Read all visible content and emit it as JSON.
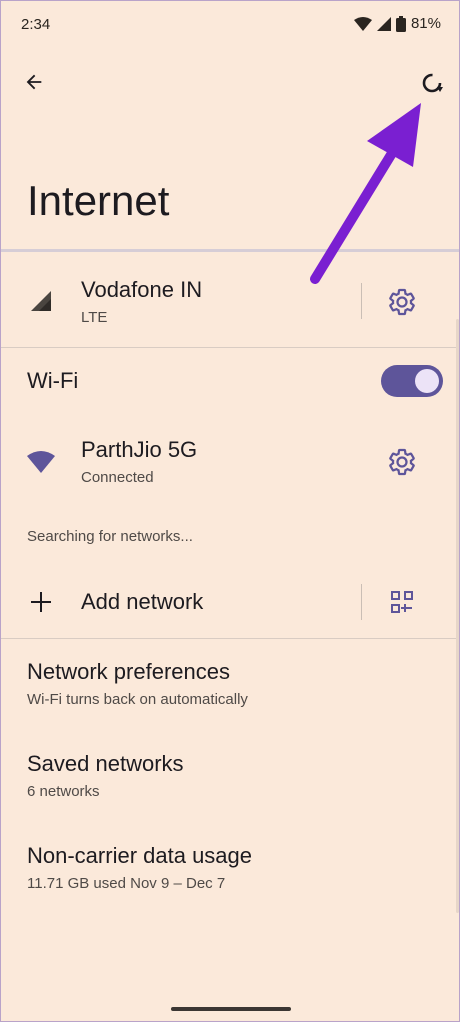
{
  "status_bar": {
    "time": "2:34",
    "battery": "81%"
  },
  "header": {
    "title": "Internet"
  },
  "mobile": {
    "carrier": "Vodafone IN",
    "network_type": "LTE"
  },
  "wifi": {
    "label": "Wi-Fi",
    "enabled": true
  },
  "connected_network": {
    "name": "ParthJio 5G",
    "status": "Connected"
  },
  "searching_text": "Searching for networks...",
  "add_network": {
    "label": "Add network"
  },
  "network_preferences": {
    "title": "Network preferences",
    "subtitle": "Wi-Fi turns back on automatically"
  },
  "saved_networks": {
    "title": "Saved networks",
    "subtitle": "6 networks"
  },
  "non_carrier_usage": {
    "title": "Non-carrier data usage",
    "subtitle": "11.71 GB used Nov 9 – Dec 7"
  },
  "colors": {
    "background": "#fbe9da",
    "accent": "#5e559a",
    "annotation_arrow": "#7a1fd1"
  },
  "icons": {
    "back": "arrow-left-icon",
    "refresh": "refresh-icon",
    "signal": "signal-icon",
    "wifi": "wifi-icon",
    "settings": "gear-icon",
    "add": "plus-icon",
    "qr": "qr-code-icon"
  }
}
